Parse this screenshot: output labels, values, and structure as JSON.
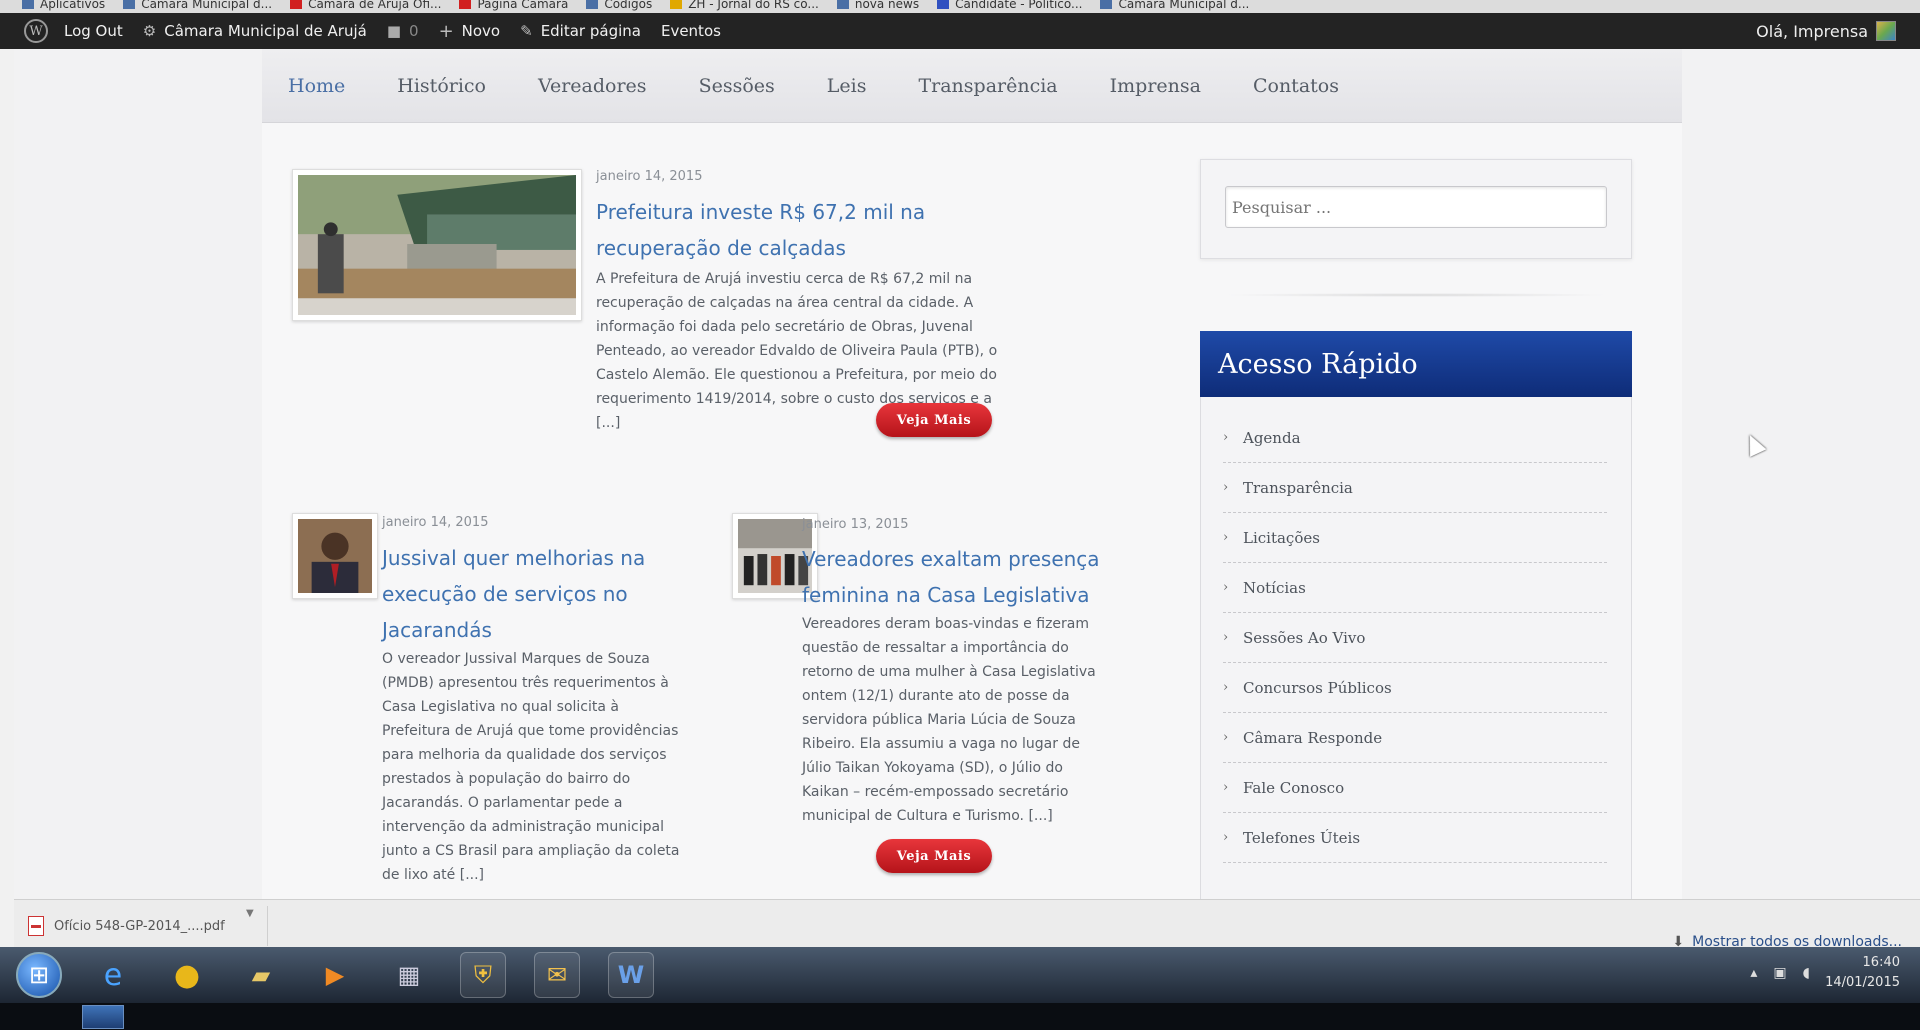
{
  "bookmarks": [
    {
      "label": "Aplicativos",
      "icon": "apps-grid-icon",
      "color": "#4a6fa5"
    },
    {
      "label": "Câmara Municipal d...",
      "icon": "page-icon",
      "color": "#4a6fa5"
    },
    {
      "label": "Câmara de Arujá Ofi...",
      "icon": "youtube-icon",
      "color": "#d12020"
    },
    {
      "label": "Página Câmara",
      "icon": "youtube-icon",
      "color": "#d12020"
    },
    {
      "label": "Códigos",
      "icon": "page-icon",
      "color": "#4a6fa5"
    },
    {
      "label": "ZH - Jornal do RS co...",
      "icon": "zh-icon",
      "color": "#e0a800"
    },
    {
      "label": "nova news",
      "icon": "page-icon",
      "color": "#4a6fa5"
    },
    {
      "label": "Candidate - Político...",
      "icon": "page-icon",
      "color": "#3050c0"
    },
    {
      "label": "Câmara Municipal d...",
      "icon": "page-icon",
      "color": "#4a6fa5"
    }
  ],
  "adminbar": {
    "logout": "Log Out",
    "site": "Câmara Municipal de Arujá",
    "comments": "0",
    "new": "Novo",
    "edit": "Editar página",
    "events": "Eventos",
    "greeting": "Olá, Imprensa"
  },
  "nav": [
    "Home",
    "Histórico",
    "Vereadores",
    "Sessões",
    "Leis",
    "Transparência",
    "Imprensa",
    "Contatos"
  ],
  "featured": {
    "date": "janeiro 14, 2015",
    "title": "Prefeitura investe R$ 67,2 mil na recuperação de calçadas",
    "excerpt": "A Prefeitura de Arujá investiu cerca de R$ 67,2 mil na recuperação de calçadas na área central da cidade. A informação foi dada pelo secretário de Obras, Juvenal Penteado, ao vereador Edvaldo de Oliveira Paula (PTB), o Castelo Alemão. Ele questionou a Prefeitura, por meio do requerimento 1419/2014, sobre o custo dos serviços e a [...]",
    "button": "Veja Mais"
  },
  "post2": {
    "date": "janeiro 14, 2015",
    "title": "Jussival quer melhorias na execução de serviços no Jacarandás",
    "excerpt": "O vereador Jussival Marques de Souza (PMDB) apresentou três requerimentos à Casa Legislativa no qual solicita à Prefeitura de Arujá que tome providências para melhoria da qualidade dos serviços prestados à população do bairro do Jacarandás. O parlamentar pede a intervenção da administração municipal junto a CS Brasil para ampliação da coleta de lixo até [...]"
  },
  "post3": {
    "date": "janeiro 13, 2015",
    "title": "Vereadores exaltam presença feminina na Casa Legislativa",
    "excerpt": "Vereadores deram boas-vindas e fizeram questão de ressaltar a importância do retorno de uma mulher à Casa Legislativa ontem (12/1) durante ato de posse da servidora pública Maria Lúcia de Souza Ribeiro. Ela assumiu a vaga no lugar de Júlio Taikan Yokoyama (SD), o Júlio do Kaikan – recém-empossado secretário municipal de Cultura e Turismo. [...]",
    "button": "Veja Mais"
  },
  "search": {
    "placeholder": "Pesquisar ..."
  },
  "quick_access": {
    "title": "Acesso Rápido",
    "items": [
      "Agenda",
      "Transparência",
      "Licitações",
      "Notícias",
      "Sessões Ao Vivo",
      "Concursos Públicos",
      "Câmara Responde",
      "Fale Conosco",
      "Telefones Úteis"
    ]
  },
  "downloads": {
    "file": "Ofício 548-GP-2014_....pdf",
    "show_all": "Mostrar todos os downloads..."
  },
  "clock": {
    "time": "16:40",
    "date": "14/01/2015"
  }
}
